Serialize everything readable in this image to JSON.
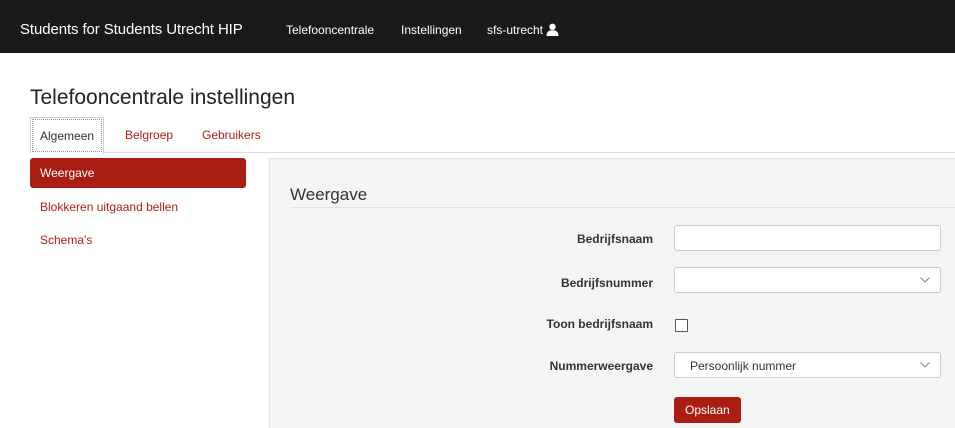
{
  "navbar": {
    "brand": "Students for Students Utrecht HIP",
    "links": [
      {
        "label": "Telefooncentrale"
      },
      {
        "label": "Instellingen"
      },
      {
        "label": "sfs-utrecht",
        "icon": "user-icon"
      }
    ]
  },
  "page": {
    "title": "Telefooncentrale instellingen"
  },
  "tabs": [
    {
      "label": "Algemeen",
      "active": true
    },
    {
      "label": "Belgroep",
      "active": false
    },
    {
      "label": "Gebruikers",
      "active": false
    }
  ],
  "sidebar": {
    "items": [
      {
        "label": "Weergave",
        "active": true
      },
      {
        "label": "Blokkeren uitgaand bellen",
        "active": false
      },
      {
        "label": "Schema's",
        "active": false
      }
    ]
  },
  "panel": {
    "title": "Weergave",
    "fields": {
      "bedrijfsnaam": {
        "label": "Bedrijfsnaam",
        "value": "",
        "placeholder": ""
      },
      "bedrijfsnummer": {
        "label": "Bedrijfsnummer",
        "value": ""
      },
      "toon_bedrijfsnaam": {
        "label": "Toon bedrijfsnaam",
        "checked": false
      },
      "nummerweergave": {
        "label": "Nummerweergave",
        "value": "Persoonlijk nummer"
      }
    },
    "save_label": "Opslaan"
  },
  "colors": {
    "navbar_bg": "#1a1a1a",
    "accent": "#a91d12",
    "link": "#b51d14",
    "panel_bg": "#f5f5f5"
  }
}
